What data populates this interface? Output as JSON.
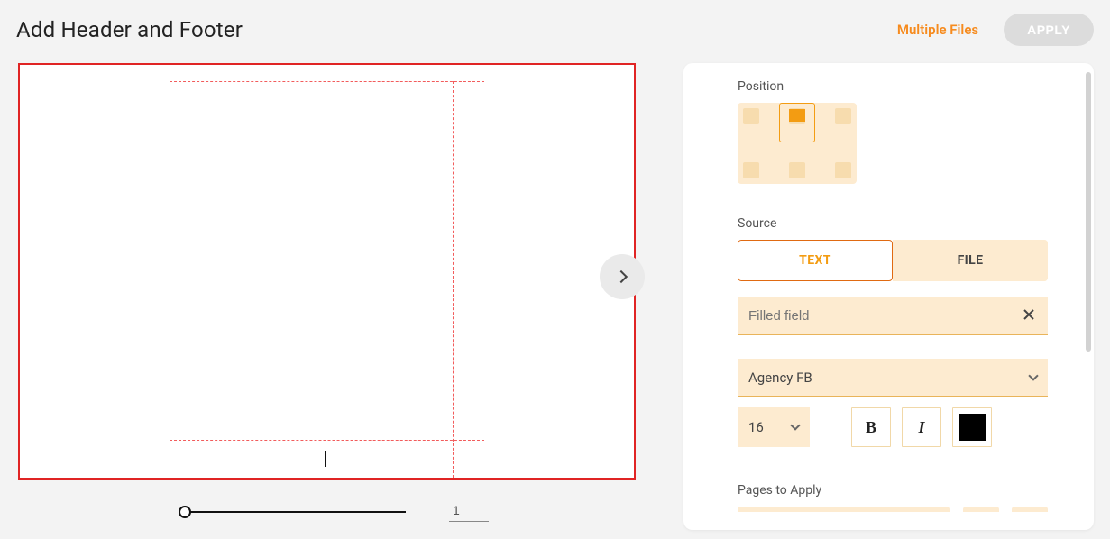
{
  "header": {
    "title": "Add Header and Footer",
    "multiple_files": "Multiple Files",
    "apply": "APPLY"
  },
  "preview": {
    "page_number": "1"
  },
  "panel": {
    "position_label": "Position",
    "source_label": "Source",
    "tabs": {
      "text": "TEXT",
      "file": "FILE"
    },
    "text_placeholder": "Filled field",
    "text_value": "",
    "font_name": "Agency FB",
    "font_size": "16",
    "color": "#000000",
    "pages_label": "Pages to Apply"
  }
}
